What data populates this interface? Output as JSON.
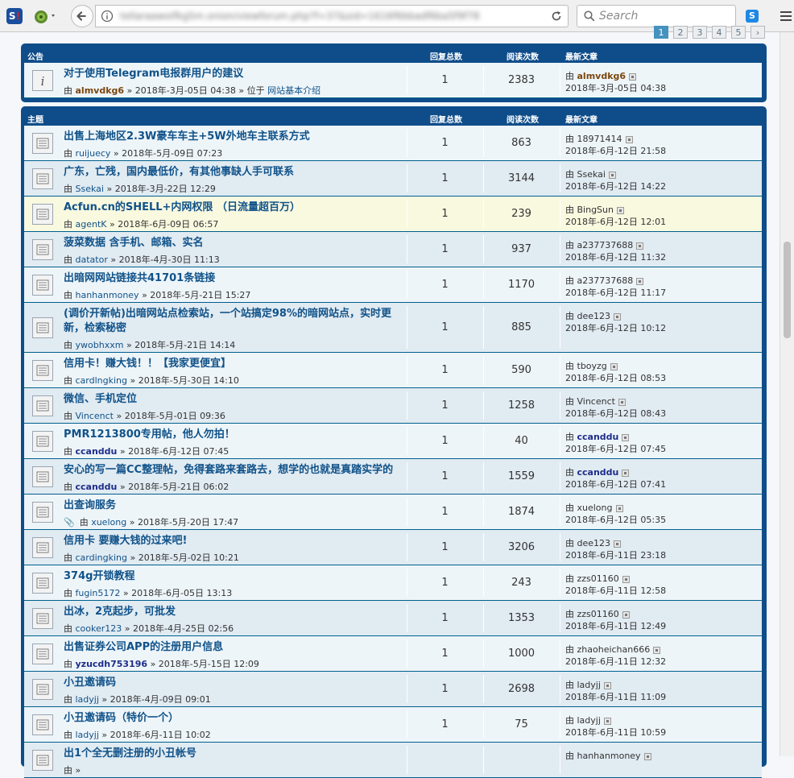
{
  "browser": {
    "url_placeholder_blurred": "tellaraawoifkg5m.onion/viewforum.php?f=37&sid=1616f6bbadf6ba5f9f78",
    "search_placeholder": "Search"
  },
  "pagination": {
    "pages": [
      "1",
      "2",
      "3",
      "4",
      "5"
    ],
    "active": "1"
  },
  "announcements": {
    "header": {
      "topic": "公告",
      "replies": "回复总数",
      "views": "阅读次数",
      "last": "最新文章"
    },
    "rows": [
      {
        "title": "对于使用Telegram电报群用户的建议",
        "by": "由",
        "author": "almvdkg6",
        "date": "2018年-3月-05日 04:38",
        "in": "» 位于",
        "forum": "网站基本介绍",
        "replies": "1",
        "views": "2383",
        "last_user": "almvdkg6",
        "last_date": "2018年-3月-05日 04:38"
      }
    ]
  },
  "topics": {
    "header": {
      "topic": "主题",
      "replies": "回复总数",
      "views": "阅读次数",
      "last": "最新文章"
    },
    "rows": [
      {
        "title": "出售上海地区2.3W豪车车主+5W外地车主联系方式",
        "by": "由",
        "author": "ruijuecy",
        "date": "2018年-5月-09日 07:23",
        "replies": "1",
        "views": "863",
        "last_by": "由",
        "last_user": "18971414",
        "last_date": "2018年-6月-12日 21:58"
      },
      {
        "title": "广东，亡残，国内最低价，有其他事缺人手可联系",
        "by": "由",
        "author": "Ssekai",
        "date": "2018年-3月-22日 12:29",
        "replies": "1",
        "views": "3144",
        "last_by": "由",
        "last_user": "Ssekai",
        "last_date": "2018年-6月-12日 14:22"
      },
      {
        "title": "Acfun.cn的SHELL+内网权限 （日流量超百万）",
        "by": "由",
        "author": "agentK",
        "date": "2018年-6月-09日 06:57",
        "replies": "1",
        "views": "239",
        "last_by": "由",
        "last_user": "BingSun",
        "last_date": "2018年-6月-12日 12:01"
      },
      {
        "title": "菠菜数据 含手机、邮箱、实名",
        "by": "由",
        "author": "datator",
        "date": "2018年-4月-30日 11:13",
        "replies": "1",
        "views": "937",
        "last_by": "由",
        "last_user": "a237737688",
        "last_date": "2018年-6月-12日 11:32"
      },
      {
        "title": "出暗网网站链接共41701条链接",
        "by": "由",
        "author": "hanhanmoney",
        "date": "2018年-5月-21日 15:27",
        "replies": "1",
        "views": "1170",
        "last_by": "由",
        "last_user": "a237737688",
        "last_date": "2018年-6月-12日 11:17"
      },
      {
        "title": "(调价开新帖)出暗网站点检索站，一个站搞定98%的暗网站点，实时更新，检索秘密",
        "by": "由",
        "author": "ywobhxxm",
        "date": "2018年-5月-21日 14:14",
        "replies": "1",
        "views": "885",
        "last_by": "由",
        "last_user": "dee123",
        "last_date": "2018年-6月-12日 10:12"
      },
      {
        "title": "信用卡！赚大钱！！【我家更便宜】",
        "by": "由",
        "author": "cardlngking",
        "date": "2018年-5月-30日 14:10",
        "replies": "1",
        "views": "590",
        "last_by": "由",
        "last_user": "tboyzg",
        "last_date": "2018年-6月-12日 08:53"
      },
      {
        "title": "微信、手机定位",
        "by": "由",
        "author": "Vincenct",
        "date": "2018年-5月-01日 09:36",
        "replies": "1",
        "views": "1258",
        "last_by": "由",
        "last_user": "Vincenct",
        "last_date": "2018年-6月-12日 08:43"
      },
      {
        "title": "PMR1213800专用帖，他人勿拍！",
        "by": "由",
        "author": "ccanddu",
        "date": "2018年-6月-12日 07:45",
        "replies": "1",
        "views": "40",
        "last_by": "由",
        "last_user": "ccanddu",
        "last_date": "2018年-6月-12日 07:45"
      },
      {
        "title": "安心的写一篇CC整理帖，免得套路来套路去，想学的也就是真踏实学的",
        "by": "由",
        "author": "ccanddu",
        "date": "2018年-5月-21日 06:02",
        "replies": "1",
        "views": "1559",
        "last_by": "由",
        "last_user": "ccanddu",
        "last_date": "2018年-6月-12日 07:41"
      },
      {
        "title": "出查询服务",
        "by": "由",
        "author": "xuelong",
        "date": "2018年-5月-20日 17:47",
        "replies": "1",
        "views": "1874",
        "last_by": "由",
        "last_user": "xuelong",
        "last_date": "2018年-6月-12日 05:35"
      },
      {
        "title": "信用卡 要赚大钱的过来吧!",
        "by": "由",
        "author": "cardingking",
        "date": "2018年-5月-02日 10:21",
        "replies": "1",
        "views": "3206",
        "last_by": "由",
        "last_user": "dee123",
        "last_date": "2018年-6月-11日 23:18"
      },
      {
        "title": "374g开锁教程",
        "by": "由",
        "author": "fugin5172",
        "date": "2018年-6月-05日 13:13",
        "replies": "1",
        "views": "243",
        "last_by": "由",
        "last_user": "zzs01160",
        "last_date": "2018年-6月-11日 12:58"
      },
      {
        "title": "出冰，2克起步，可批发",
        "by": "由",
        "author": "cooker123",
        "date": "2018年-4月-25日 02:56",
        "replies": "1",
        "views": "1353",
        "last_by": "由",
        "last_user": "zzs01160",
        "last_date": "2018年-6月-11日 12:49"
      },
      {
        "title": "出售证券公司APP的注册用户信息",
        "by": "由",
        "author": "yzucdh753196",
        "date": "2018年-5月-15日 12:09",
        "replies": "1",
        "views": "1000",
        "last_by": "由",
        "last_user": "zhaoheichan666",
        "last_date": "2018年-6月-11日 12:32"
      },
      {
        "title": "小丑邀请码",
        "by": "由",
        "author": "ladyjj",
        "date": "2018年-4月-09日 09:01",
        "replies": "1",
        "views": "2698",
        "last_by": "由",
        "last_user": "ladyjj",
        "last_date": "2018年-6月-11日 11:09"
      },
      {
        "title": "小丑邀请码（特价一个）",
        "by": "由",
        "author": "ladyjj",
        "date": "2018年-6月-11日 10:02",
        "replies": "1",
        "views": "75",
        "last_by": "由",
        "last_user": "ladyjj",
        "last_date": "2018年-6月-11日 10:59"
      },
      {
        "title": "出1个全无删注册的小丑帐号",
        "by": "由",
        "author": "",
        "date": "",
        "replies": "",
        "views": "",
        "last_by": "由",
        "last_user": "hanhanmoney",
        "last_date": ""
      }
    ]
  }
}
